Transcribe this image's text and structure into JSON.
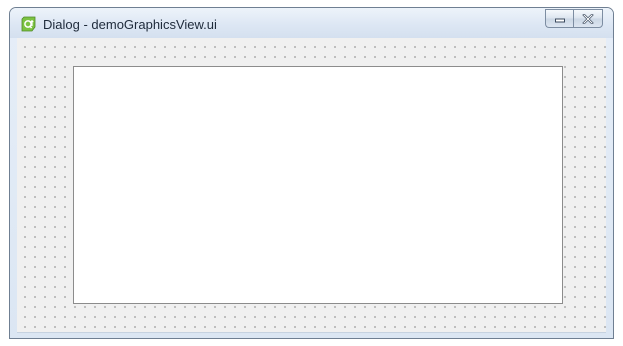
{
  "window": {
    "title": "Dialog - demoGraphicsView.ui",
    "icon": "qt-designer-icon",
    "buttons": [
      {
        "name": "minimize",
        "icon": "minimize-icon"
      },
      {
        "name": "close",
        "icon": "close-icon"
      }
    ]
  },
  "client": {
    "grid": "dotted",
    "widget": "graphics-view"
  },
  "colors": {
    "icon_green": "#7cc242",
    "titlebar": "#dbe6f3",
    "client_bg": "#f0f0f0",
    "view_bg": "#ffffff"
  }
}
